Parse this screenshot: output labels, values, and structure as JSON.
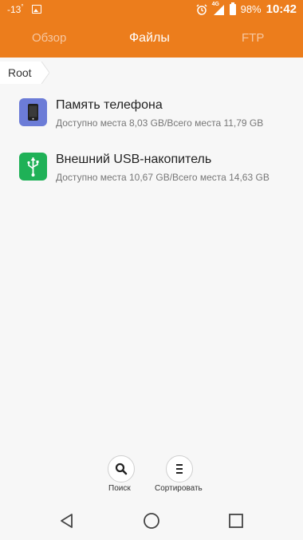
{
  "status_bar": {
    "temperature": "-13",
    "temperature_unit": "°",
    "network": "4G",
    "battery": "98%",
    "time": "10:42"
  },
  "tabs": [
    {
      "label": "Обзор",
      "active": false
    },
    {
      "label": "Файлы",
      "active": true
    },
    {
      "label": "FTP",
      "active": false
    }
  ],
  "breadcrumb": {
    "root": "Root"
  },
  "storage_items": [
    {
      "icon": "phone-memory-icon",
      "title": "Память телефона",
      "subtitle": "Доступно места 8,03 GB/Всего места 11,79 GB"
    },
    {
      "icon": "usb-icon",
      "title": "Внешний USB-накопитель",
      "subtitle": "Доступно места 10,67 GB/Всего места 14,63 GB"
    }
  ],
  "actions": {
    "search_label": "Поиск",
    "sort_label": "Сортировать"
  },
  "colors": {
    "accent": "#ec7d1c",
    "phone_icon_bg": "#6c7cd7",
    "usb_icon_bg": "#1fb157"
  }
}
